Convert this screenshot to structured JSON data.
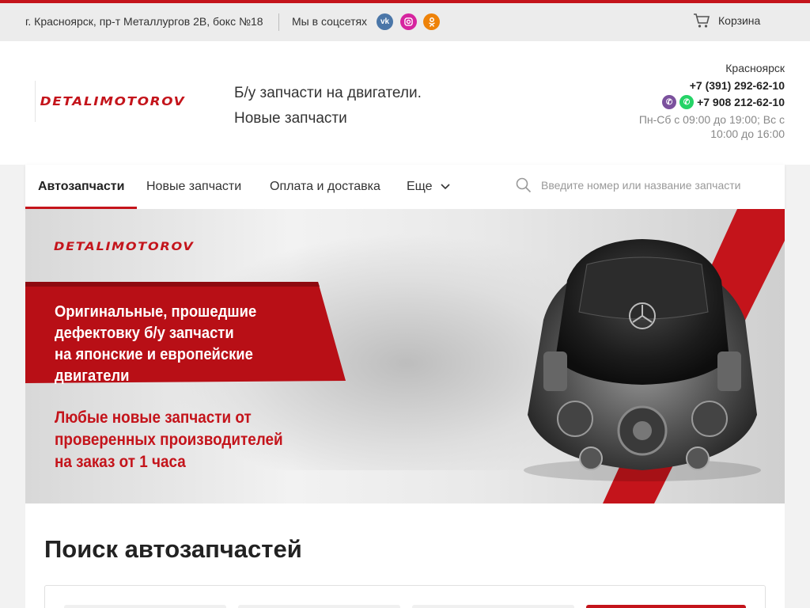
{
  "topbar": {
    "address": "г. Красноярск, пр-т Металлургов 2В, бокс №18",
    "social_label": "Мы в соцсетях",
    "social": [
      {
        "icon": "vk-icon",
        "glyph": "vk"
      },
      {
        "icon": "instagram-icon",
        "glyph": "◎"
      },
      {
        "icon": "odnoklassniki-icon",
        "glyph": "ok"
      }
    ],
    "cart_label": "Корзина"
  },
  "header": {
    "logo": "DETALIMOTOROV",
    "tagline_1": "Б/у запчасти на двигатели.",
    "tagline_2": "Новые запчасти",
    "city": "Красноярск",
    "phone_1": "+7 (391) 292-62-10",
    "phone_2": "+7 908 212-62-10",
    "hours": "Пн-Сб с 09:00 до 19:00; Вс с 10:00 до 16:00"
  },
  "nav": {
    "items": [
      {
        "label": "Автозапчасти",
        "active": true
      },
      {
        "label": "Новые запчасти",
        "active": false
      },
      {
        "label": "Оплата и доставка",
        "active": false
      },
      {
        "label": "Еще",
        "active": false
      }
    ],
    "search_placeholder": "Введите номер или название запчасти"
  },
  "banner": {
    "logo": "DETALIMOTOROV",
    "headline_1": "Оригинальные, прошедшие",
    "headline_2": "дефектовку б/у запчасти",
    "headline_3": "на японские и европейские двигатели",
    "sub_1": "Любые новые запчасти от",
    "sub_2": "проверенных производителей",
    "sub_3": "на заказ от 1 часа"
  },
  "search_section": {
    "title": "Поиск автозапчастей"
  },
  "colors": {
    "accent": "#c4141b"
  }
}
